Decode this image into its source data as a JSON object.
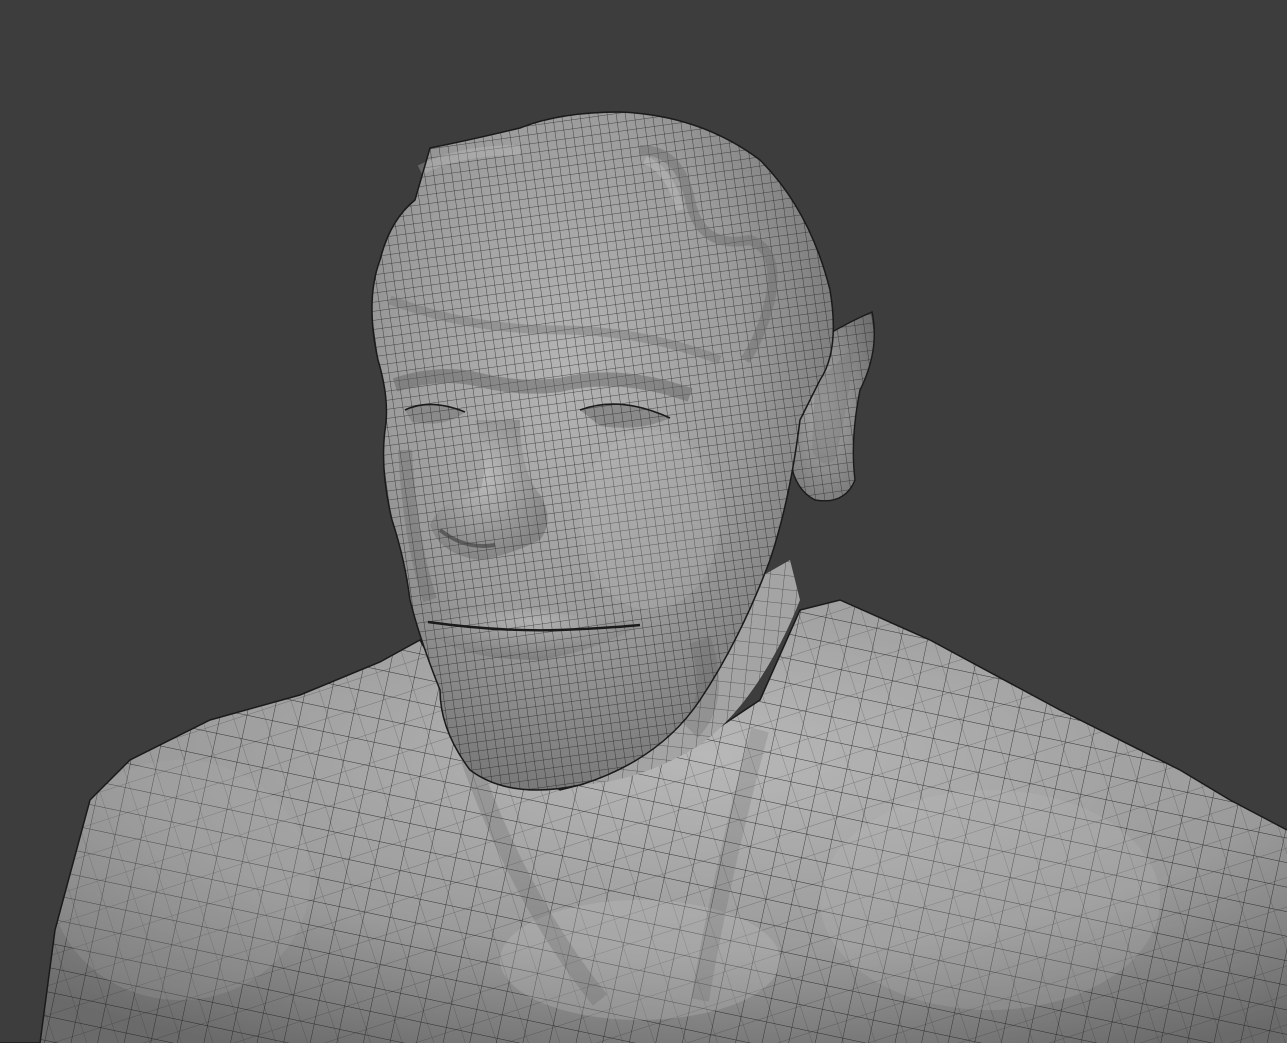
{
  "viewport": {
    "background_color": "#3d3d3d",
    "mesh_color": "#9a9a9a",
    "wire_color": "#1e1e1e",
    "highlight_color": "#bdbdbd",
    "shadow_color": "#6c6c6c",
    "subject": "wireframe-sculpt-ogre-bust"
  }
}
